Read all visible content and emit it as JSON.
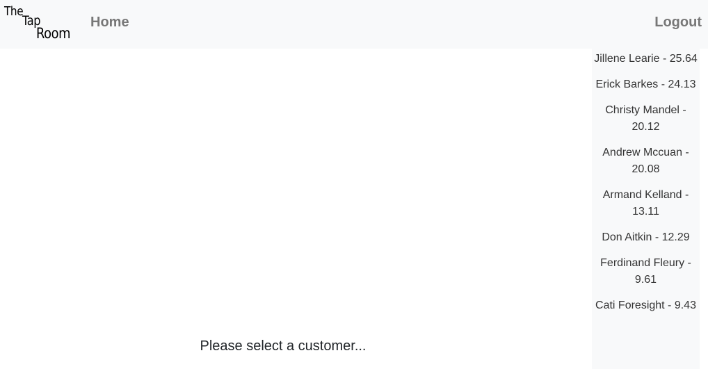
{
  "logo": {
    "line1": "The",
    "line2": "Tap",
    "line3": "Room"
  },
  "nav": {
    "home_label": "Home",
    "logout_label": "Logout"
  },
  "customers": [
    {
      "name": "Jillene Learie",
      "value": "25.64",
      "label": "Jillene Learie - 25.64"
    },
    {
      "name": "Erick Barkes",
      "value": "24.13",
      "label": "Erick Barkes - 24.13"
    },
    {
      "name": "Christy Mandel",
      "value": "20.12",
      "label": "Christy Mandel - 20.12"
    },
    {
      "name": "Andrew Mccuan",
      "value": "20.08",
      "label": "Andrew Mccuan - 20.08"
    },
    {
      "name": "Armand Kelland",
      "value": "13.11",
      "label": "Armand Kelland - 13.11"
    },
    {
      "name": "Don Aitkin",
      "value": "12.29",
      "label": "Don Aitkin - 12.29"
    },
    {
      "name": "Ferdinand Fleury",
      "value": "9.61",
      "label": "Ferdinand Fleury - 9.61"
    },
    {
      "name": "Cati Foresight",
      "value": "9.43",
      "label": "Cati Foresight - 9.43"
    }
  ],
  "main": {
    "prompt": "Please select a customer..."
  }
}
